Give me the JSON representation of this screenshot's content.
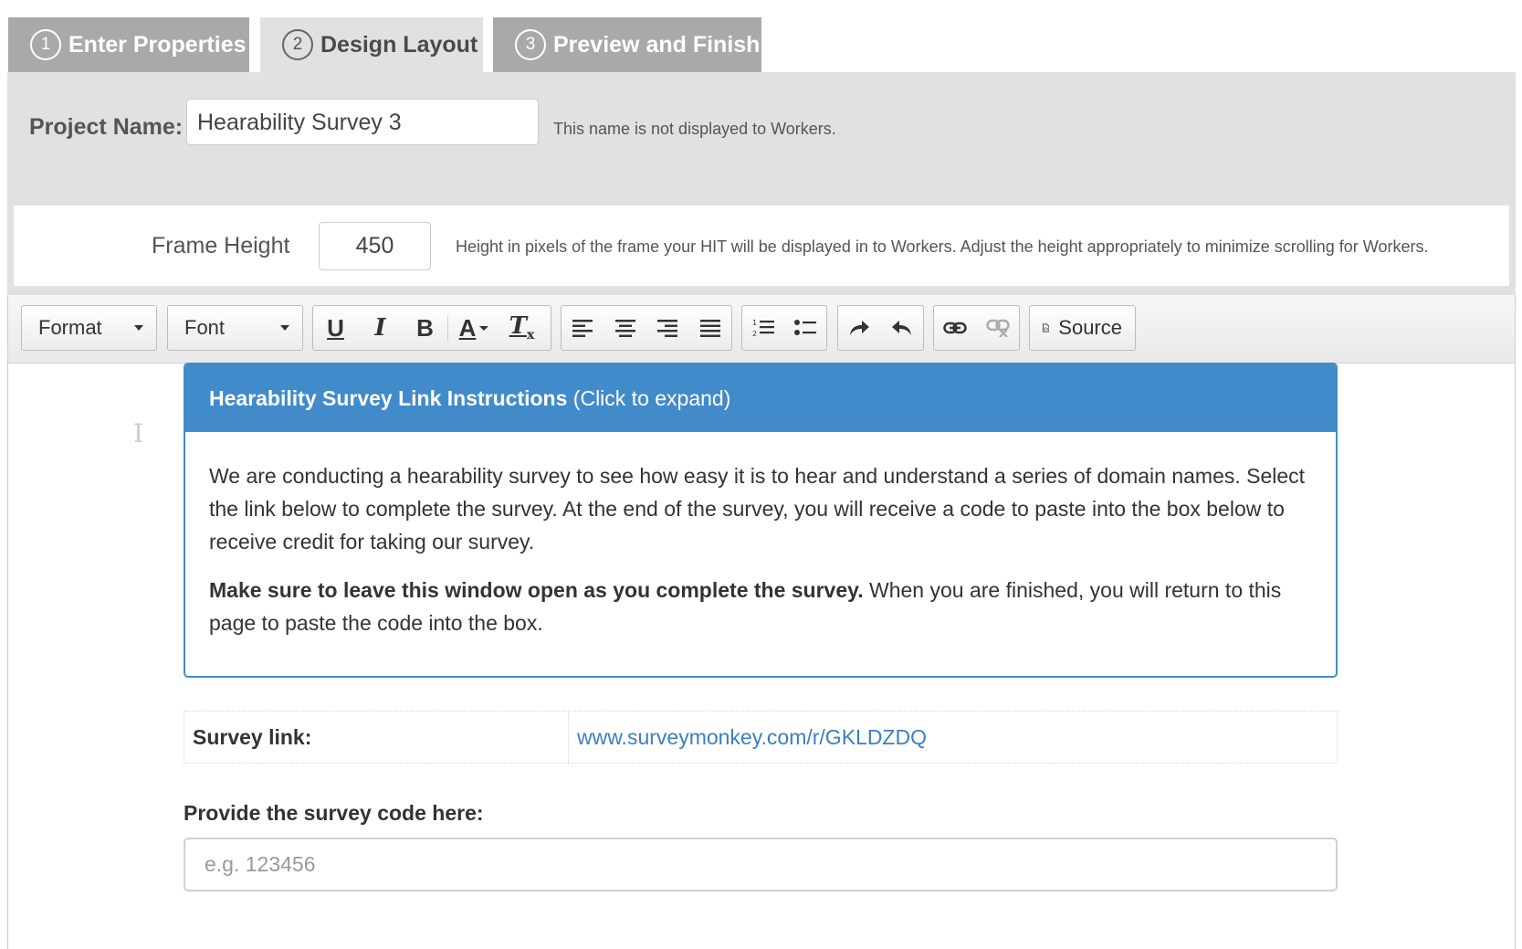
{
  "tabs": [
    {
      "number": "1",
      "label": "Enter Properties",
      "active": false
    },
    {
      "number": "2",
      "label": "Design Layout",
      "active": true
    },
    {
      "number": "3",
      "label": "Preview and Finish",
      "active": false
    }
  ],
  "properties": {
    "project_name_label": "Project Name:",
    "project_name_value": "Hearability Survey 3",
    "project_name_hint": "This name is not displayed to Workers.",
    "frame_height_label": "Frame Height",
    "frame_height_value": "450",
    "frame_height_hint": "Height in pixels of the frame your HIT will be displayed in to Workers. Adjust the height appropriately to minimize scrolling for Workers."
  },
  "toolbar": {
    "format_label": "Format",
    "font_label": "Font",
    "source_label": "Source",
    "icons": [
      "underline-icon",
      "italic-icon",
      "bold-icon",
      "text-color-icon",
      "remove-format-icon",
      "align-left-icon",
      "align-center-icon",
      "align-right-icon",
      "justify-icon",
      "numbered-list-icon",
      "bulleted-list-icon",
      "redo-icon",
      "undo-icon",
      "link-icon",
      "unlink-icon",
      "source-icon"
    ]
  },
  "content": {
    "panel_title_bold": "Hearability Survey Link Instructions",
    "panel_title_rest": " (Click to expand)",
    "paragraph1": "We are conducting a hearability survey to see how easy it is to hear and understand a series of domain names. Select the link below to complete the survey. At the end of the survey, you will receive a code to paste into the box below to receive credit for taking our survey.",
    "paragraph2_bold": "Make sure to leave this window open as you complete the survey.",
    "paragraph2_rest": " When you are finished, you will return to this page to paste the code into the box.",
    "survey_link_label": "Survey link:",
    "survey_link_value": "www.surveymonkey.com/r/GKLDZDQ",
    "code_label": "Provide the survey code here:",
    "code_placeholder": "e.g. 123456"
  },
  "colors": {
    "panel_blue": "#428bca",
    "tab_inactive": "#a9a9a9",
    "tab_active": "#e1e1e1",
    "link_blue": "#3a7fc0"
  }
}
